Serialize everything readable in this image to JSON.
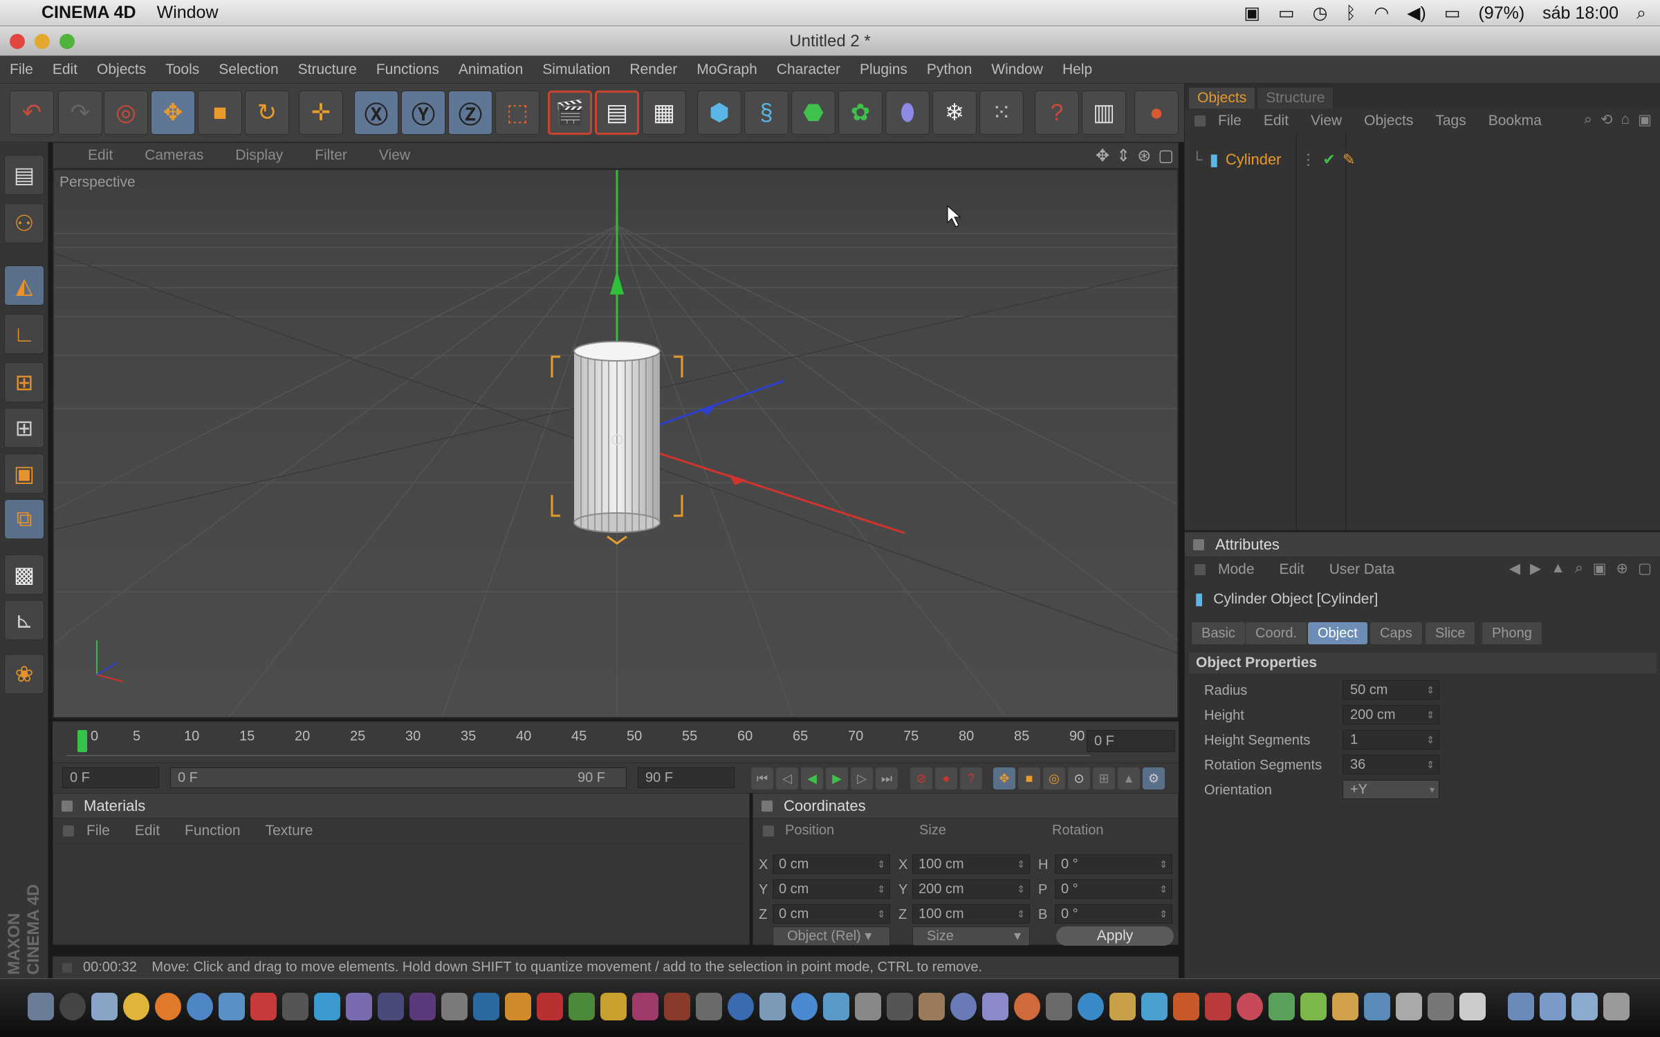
{
  "mac_menubar": {
    "app_name": "CINEMA 4D",
    "menu": "Window",
    "battery": "(97%)",
    "clock": "sáb 18:00"
  },
  "window": {
    "title": "Untitled 2 *"
  },
  "menubar": [
    "File",
    "Edit",
    "Objects",
    "Tools",
    "Selection",
    "Structure",
    "Functions",
    "Animation",
    "Simulation",
    "Render",
    "MoGraph",
    "Character",
    "Plugins",
    "Python",
    "Window",
    "Help"
  ],
  "viewport": {
    "menu": [
      "Edit",
      "Cameras",
      "Display",
      "Filter",
      "View"
    ],
    "label": "Perspective"
  },
  "timeline": {
    "ticks": [
      "0",
      "5",
      "10",
      "15",
      "20",
      "25",
      "30",
      "35",
      "40",
      "45",
      "50",
      "55",
      "60",
      "65",
      "70",
      "75",
      "80",
      "85",
      "90"
    ],
    "current_frame": "0 F",
    "start_field": "0 F",
    "range_start": "0 F",
    "range_end": "90 F",
    "end_field": "90 F"
  },
  "materials": {
    "title": "Materials",
    "menu": [
      "File",
      "Edit",
      "Function",
      "Texture"
    ]
  },
  "coordinates": {
    "title": "Coordinates",
    "headers": [
      "Position",
      "Size",
      "Rotation"
    ],
    "rows": [
      {
        "axis": "X",
        "pos": "0 cm",
        "size_axis": "X",
        "size": "100 cm",
        "rot_axis": "H",
        "rot": "0 °"
      },
      {
        "axis": "Y",
        "pos": "0 cm",
        "size_axis": "Y",
        "size": "200 cm",
        "rot_axis": "P",
        "rot": "0 °"
      },
      {
        "axis": "Z",
        "pos": "0 cm",
        "size_axis": "Z",
        "size": "100 cm",
        "rot_axis": "B",
        "rot": "0 °"
      }
    ],
    "mode_dropdown": "Object (Rel)",
    "size_dropdown": "Size",
    "apply": "Apply"
  },
  "status": {
    "time": "00:00:32",
    "message": "Move: Click and drag to move elements. Hold down SHIFT to quantize movement / add to the selection in point mode, CTRL to remove."
  },
  "objects_panel": {
    "tabs": [
      "Objects",
      "Structure"
    ],
    "menu": [
      "File",
      "Edit",
      "View",
      "Objects",
      "Tags",
      "Bookma"
    ],
    "items": [
      {
        "name": "Cylinder"
      }
    ]
  },
  "attributes": {
    "title": "Attributes",
    "menu": [
      "Mode",
      "Edit",
      "User Data"
    ],
    "object_title": "Cylinder Object [Cylinder]",
    "tabs": [
      "Basic",
      "Coord.",
      "Object",
      "Caps",
      "Slice",
      "Phong"
    ],
    "active_tab": "Object",
    "section": "Object Properties",
    "props": [
      {
        "label": "Radius",
        "value": "50 cm"
      },
      {
        "label": "Height",
        "value": "200 cm"
      },
      {
        "label": "Height Segments",
        "value": "1"
      },
      {
        "label": "Rotation Segments",
        "value": "36"
      },
      {
        "label": "Orientation",
        "value": "+Y"
      }
    ]
  },
  "branding": "MAXON CINEMA 4D",
  "colors": {
    "accent_orange": "#e89a2c",
    "selection_blue": "#6d8db5",
    "axis_x": "#d0342c",
    "axis_y": "#2fbf3a",
    "axis_z": "#2f3fd0"
  }
}
